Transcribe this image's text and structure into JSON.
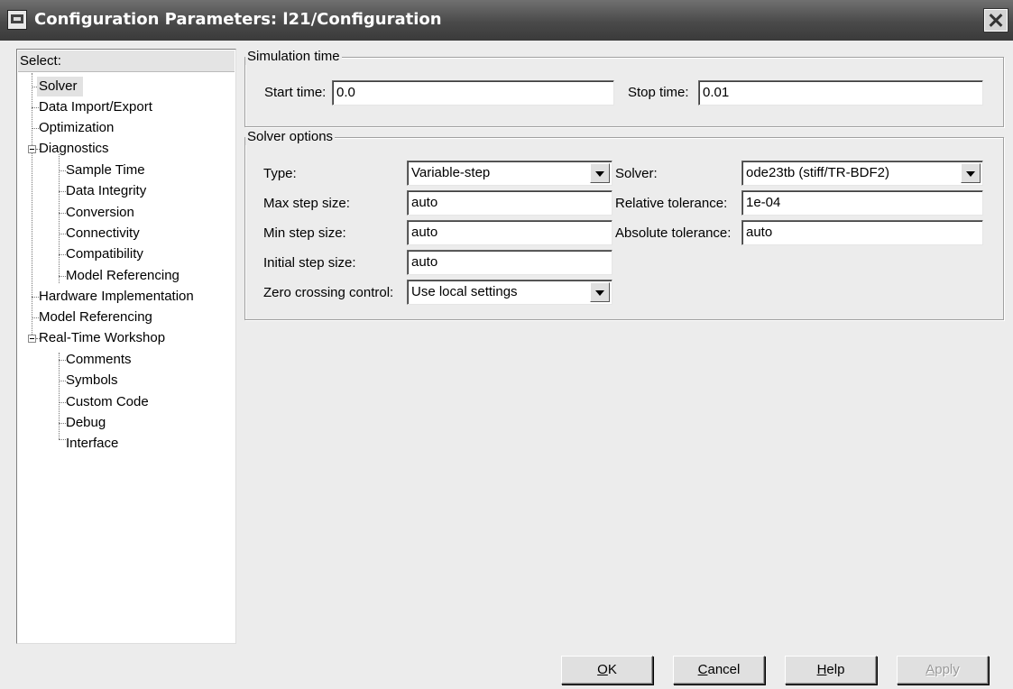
{
  "window": {
    "title": "Configuration Parameters: l21/Configuration"
  },
  "tree": {
    "header": "Select:",
    "items": [
      {
        "label": "Solver"
      },
      {
        "label": "Data Import/Export"
      },
      {
        "label": "Optimization"
      },
      {
        "label": "Diagnostics"
      },
      {
        "label": "Sample Time"
      },
      {
        "label": "Data Integrity"
      },
      {
        "label": "Conversion"
      },
      {
        "label": "Connectivity"
      },
      {
        "label": "Compatibility"
      },
      {
        "label": "Model Referencing"
      },
      {
        "label": "Hardware Implementation"
      },
      {
        "label": "Model Referencing"
      },
      {
        "label": "Real-Time Workshop"
      },
      {
        "label": "Comments"
      },
      {
        "label": "Symbols"
      },
      {
        "label": "Custom Code"
      },
      {
        "label": "Debug"
      },
      {
        "label": "Interface"
      }
    ],
    "selected": "Solver"
  },
  "simulation_time": {
    "legend": "Simulation time",
    "start_label": "Start time:",
    "start_value": "0.0",
    "stop_label": "Stop time:",
    "stop_value": "0.01"
  },
  "solver_options": {
    "legend": "Solver options",
    "type_label": "Type:",
    "type_value": "Variable-step",
    "solver_label": "Solver:",
    "solver_value": "ode23tb (stiff/TR-BDF2)",
    "max_step_label": "Max step size:",
    "max_step_value": "auto",
    "rel_tol_label": "Relative tolerance:",
    "rel_tol_value": "1e-04",
    "min_step_label": "Min step size:",
    "min_step_value": "auto",
    "abs_tol_label": "Absolute tolerance:",
    "abs_tol_value": "auto",
    "init_step_label": "Initial step size:",
    "init_step_value": "auto",
    "zero_cross_label": "Zero crossing control:",
    "zero_cross_value": "Use local settings"
  },
  "buttons": {
    "ok_accel": "O",
    "ok_rest": "K",
    "cancel_accel": "C",
    "cancel_rest": "ancel",
    "help_accel": "H",
    "help_rest": "elp",
    "apply_accel": "A",
    "apply_rest": "pply"
  }
}
